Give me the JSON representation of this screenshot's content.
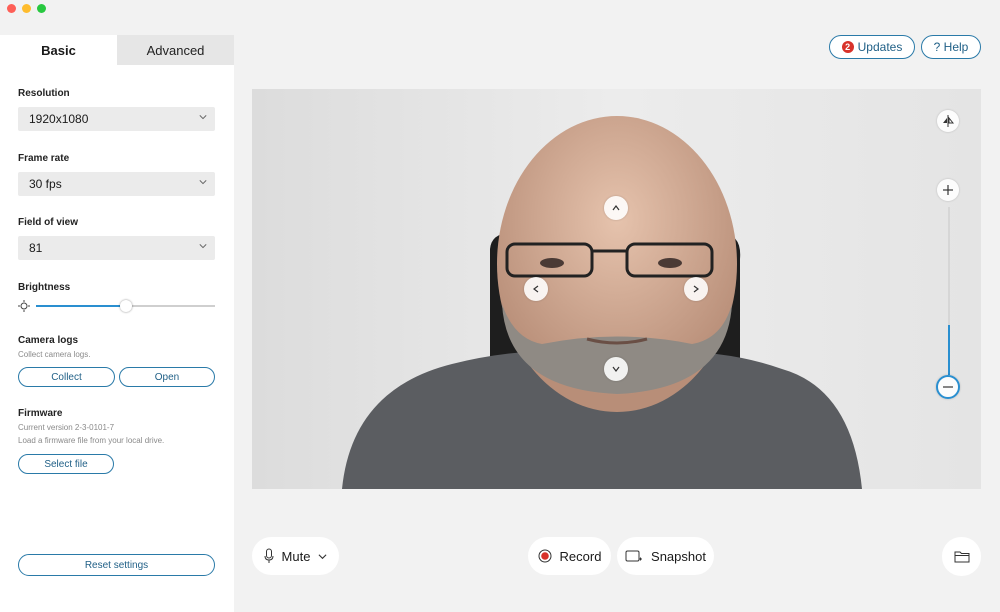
{
  "sidebar": {
    "tabs": [
      {
        "label": "Basic"
      },
      {
        "label": "Advanced"
      }
    ],
    "resolution": {
      "label": "Resolution",
      "value": "1920x1080"
    },
    "frame_rate": {
      "label": "Frame rate",
      "value": "30 fps"
    },
    "field_of_view": {
      "label": "Field of view",
      "value": "81"
    },
    "brightness": {
      "label": "Brightness",
      "level": 0.5
    },
    "camera_logs": {
      "label": "Camera logs",
      "hint": "Collect camera logs.",
      "collect_label": "Collect",
      "open_label": "Open"
    },
    "firmware": {
      "label": "Firmware",
      "version": "Current version 2-3-0101-7",
      "hint": "Load a firmware file from your local drive.",
      "select_label": "Select file"
    },
    "reset_label": "Reset settings"
  },
  "header": {
    "updates_label": "Updates",
    "updates_count": "2",
    "help_label": "? Help"
  },
  "preview": {
    "zoom_level": 0.1,
    "icons": [
      "flip-icon",
      "zoom-in-icon",
      "zoom-out-icon",
      "pan-up-icon",
      "pan-left-icon",
      "pan-right-icon",
      "pan-down-icon"
    ]
  },
  "bottom": {
    "mute_label": "Mute",
    "record_label": "Record",
    "snapshot_label": "Snapshot"
  },
  "colors": {
    "accent": "#2a7aa8",
    "record": "#d8322a",
    "badge": "#d8322a",
    "zoom": "#2a8fd0"
  }
}
